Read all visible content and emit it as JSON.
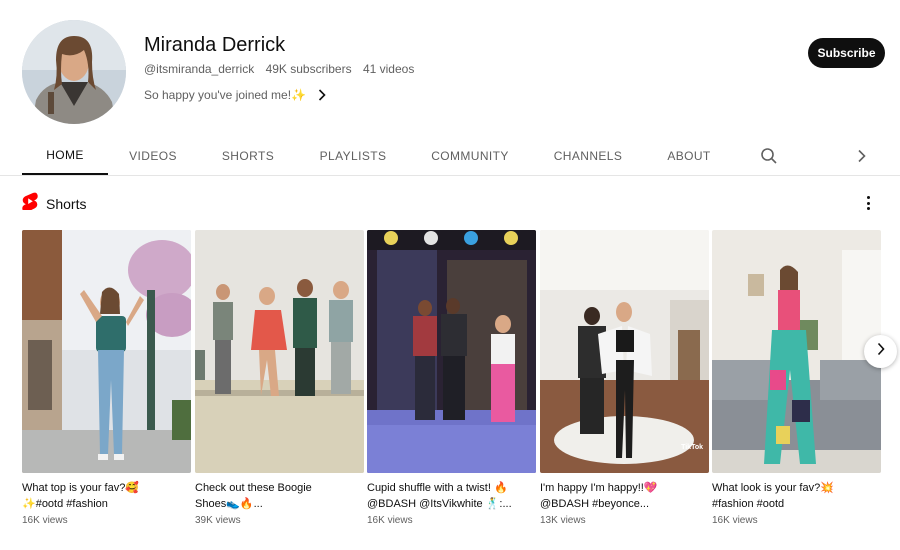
{
  "channel": {
    "name": "Miranda Derrick",
    "handle": "@itsmiranda_derrick",
    "subscribers": "49K subscribers",
    "videos": "41 videos",
    "about": "So happy you've joined me!✨"
  },
  "subscribe_label": "Subscribe",
  "tabs": [
    {
      "label": "HOME",
      "active": true
    },
    {
      "label": "VIDEOS"
    },
    {
      "label": "SHORTS"
    },
    {
      "label": "PLAYLISTS"
    },
    {
      "label": "COMMUNITY"
    },
    {
      "label": "CHANNELS"
    },
    {
      "label": "ABOUT"
    }
  ],
  "tab_icons": [
    "search-icon",
    "chevron-right-icon"
  ],
  "shorts": {
    "title": "Shorts",
    "items": [
      {
        "title1": "What top is your fav?🥰",
        "title2": "✨#ootd #fashion",
        "views": "16K views"
      },
      {
        "title1": "Check out these Boogie",
        "title2": "Shoes👟🔥...",
        "views": "39K views"
      },
      {
        "title1": "Cupid shuffle with a twist! 🔥",
        "title2": "@BDASH @ItsVikwhite 🕺:...",
        "views": "16K views"
      },
      {
        "title1": "I'm happy I'm happy!!💖",
        "title2": "@BDASH #beyonce...",
        "views": "13K views"
      },
      {
        "title1": "What look is your fav?💥",
        "title2": "#fashion #ootd",
        "views": "16K views"
      }
    ]
  },
  "colors": {
    "accent_red": "#ff0000",
    "text_primary": "#0f0f0f",
    "text_secondary": "#606060",
    "subscribe_bg": "#0f0f0f"
  },
  "watermark": "TikTok"
}
